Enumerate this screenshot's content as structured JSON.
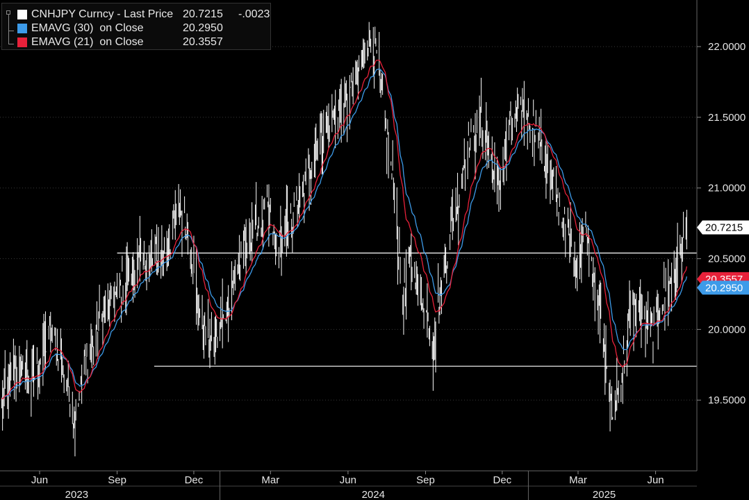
{
  "legend": {
    "title": "CNHJPY Curncy - Last Price",
    "last_value": "20.7215",
    "last_change": "-.0023",
    "ema30_label": "EMAVG (30)  on Close",
    "ema30_value": "20.2950",
    "ema21_label": "EMAVG (21)  on Close",
    "ema21_value": "20.3557"
  },
  "chart_data": {
    "type": "line",
    "ylim": [
      19.0,
      22.3
    ],
    "ytick_values": [
      19.5,
      20.0,
      20.5,
      21.0,
      21.5,
      22.0
    ],
    "ytick_labels": [
      "19.5000",
      "20.0000",
      "20.5000",
      "21.0000",
      "21.5000",
      "22.0000"
    ],
    "xlim": [
      "2023-04-15",
      "2025-07-20"
    ],
    "month_ticks": [
      {
        "date": "2023-06-01",
        "label": "Jun"
      },
      {
        "date": "2023-09-01",
        "label": "Sep"
      },
      {
        "date": "2023-12-01",
        "label": "Dec"
      },
      {
        "date": "2024-03-01",
        "label": "Mar"
      },
      {
        "date": "2024-06-01",
        "label": "Jun"
      },
      {
        "date": "2024-09-01",
        "label": "Sep"
      },
      {
        "date": "2024-12-01",
        "label": "Dec"
      },
      {
        "date": "2025-03-01",
        "label": "Mar"
      },
      {
        "date": "2025-06-01",
        "label": "Jun"
      }
    ],
    "year_labels": [
      {
        "date": "2023-07-15",
        "label": "2023"
      },
      {
        "date": "2024-07-01",
        "label": "2024"
      },
      {
        "date": "2025-04-01",
        "label": "2025"
      }
    ],
    "year_boundaries": [
      "2024-01-01",
      "2025-01-01"
    ],
    "price_anchors": [
      [
        "2023-04-15",
        19.45
      ],
      [
        "2023-05-01",
        19.7
      ],
      [
        "2023-05-25",
        19.65
      ],
      [
        "2023-06-15",
        20.0
      ],
      [
        "2023-07-05",
        19.6
      ],
      [
        "2023-07-12",
        19.35
      ],
      [
        "2023-07-25",
        19.75
      ],
      [
        "2023-08-15",
        20.1
      ],
      [
        "2023-09-05",
        20.3
      ],
      [
        "2023-09-25",
        20.45
      ],
      [
        "2023-10-15",
        20.5
      ],
      [
        "2023-11-01",
        20.6
      ],
      [
        "2023-11-15",
        20.85
      ],
      [
        "2023-11-25",
        20.7
      ],
      [
        "2023-12-05",
        20.2
      ],
      [
        "2023-12-20",
        19.9
      ],
      [
        "2024-01-05",
        20.05
      ],
      [
        "2024-01-20",
        20.4
      ],
      [
        "2024-02-10",
        20.7
      ],
      [
        "2024-02-25",
        20.85
      ],
      [
        "2024-03-10",
        20.55
      ],
      [
        "2024-03-25",
        20.75
      ],
      [
        "2024-04-15",
        21.1
      ],
      [
        "2024-04-25",
        21.3
      ],
      [
        "2024-05-10",
        21.5
      ],
      [
        "2024-05-25",
        21.55
      ],
      [
        "2024-06-10",
        21.75
      ],
      [
        "2024-06-25",
        22.05
      ],
      [
        "2024-07-05",
        21.95
      ],
      [
        "2024-07-15",
        21.45
      ],
      [
        "2024-07-25",
        21.0
      ],
      [
        "2024-08-05",
        20.2
      ],
      [
        "2024-08-15",
        20.5
      ],
      [
        "2024-08-25",
        20.3
      ],
      [
        "2024-09-10",
        19.9
      ],
      [
        "2024-09-20",
        20.3
      ],
      [
        "2024-10-05",
        20.8
      ],
      [
        "2024-10-20",
        21.3
      ],
      [
        "2024-11-05",
        21.45
      ],
      [
        "2024-11-15",
        21.3
      ],
      [
        "2024-11-25",
        20.95
      ],
      [
        "2024-12-10",
        21.4
      ],
      [
        "2024-12-25",
        21.55
      ],
      [
        "2025-01-10",
        21.45
      ],
      [
        "2025-01-25",
        21.1
      ],
      [
        "2025-02-10",
        20.8
      ],
      [
        "2025-02-25",
        20.5
      ],
      [
        "2025-03-10",
        20.7
      ],
      [
        "2025-03-20",
        20.4
      ],
      [
        "2025-04-01",
        19.9
      ],
      [
        "2025-04-10",
        19.4
      ],
      [
        "2025-04-20",
        19.6
      ],
      [
        "2025-05-01",
        20.1
      ],
      [
        "2025-05-15",
        20.15
      ],
      [
        "2025-05-25",
        19.95
      ],
      [
        "2025-06-10",
        20.2
      ],
      [
        "2025-06-25",
        20.4
      ],
      [
        "2025-07-08",
        20.72
      ]
    ],
    "ema_periods": {
      "ema30": 30,
      "ema21": 21
    },
    "last_value": 20.7215,
    "ema30_last": 20.295,
    "ema21_last": 20.3557,
    "hlines": [
      {
        "y": 20.54,
        "from": "2023-09-01",
        "to": "2025-07-20"
      },
      {
        "y": 19.74,
        "from": "2023-10-15",
        "to": "2025-07-20"
      }
    ],
    "colors": {
      "background": "#000000",
      "price": "#ffffff",
      "ema30": "#3d9be9",
      "ema21": "#e8213a",
      "axis_text": "#e6e6e6",
      "hline": "#ffffff"
    }
  }
}
